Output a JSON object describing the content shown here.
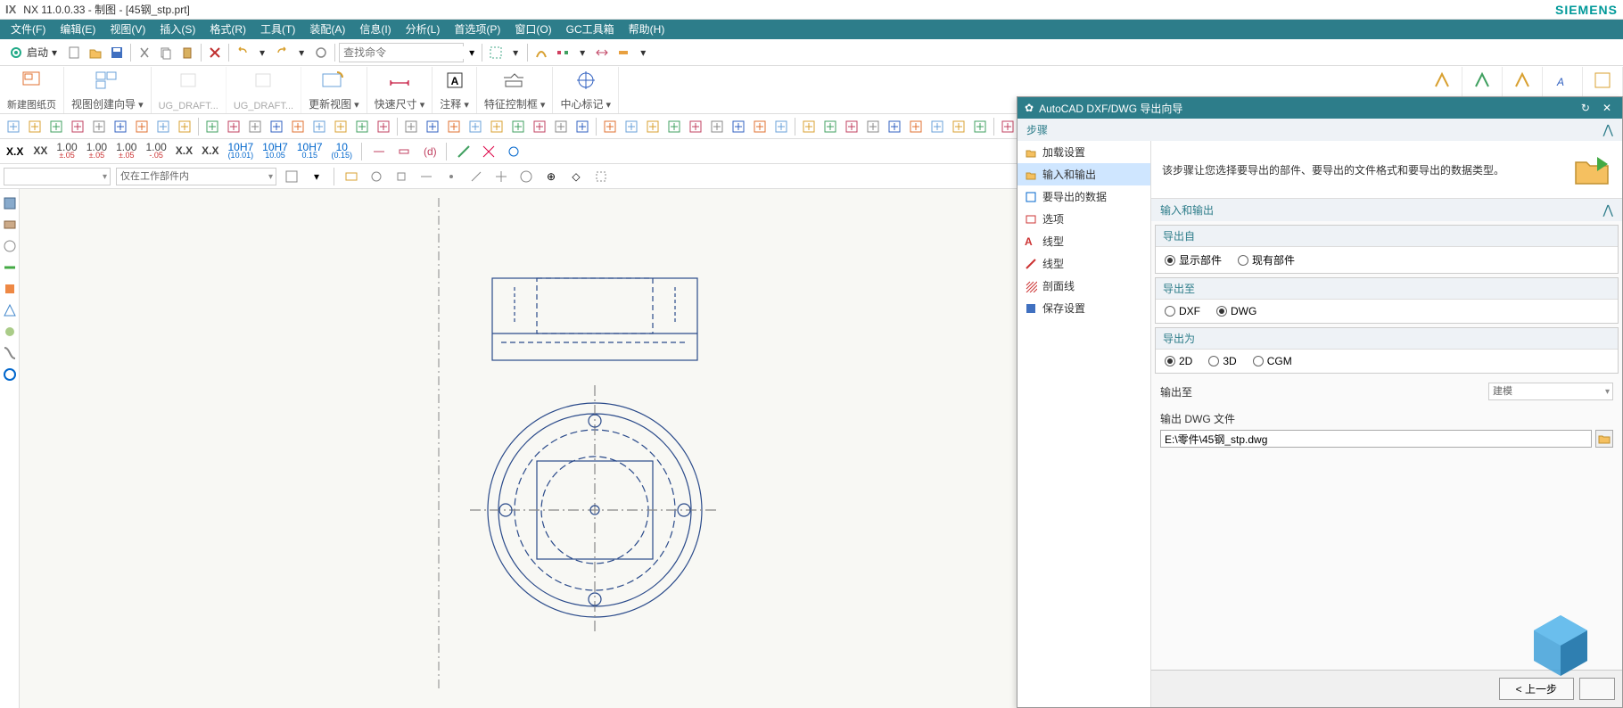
{
  "title": {
    "app": "NX 11.0.0.33",
    "mode": "制图",
    "file": "[45钢_stp.prt]",
    "brand": "SIEMENS"
  },
  "menu": [
    "文件(F)",
    "编辑(E)",
    "视图(V)",
    "插入(S)",
    "格式(R)",
    "工具(T)",
    "装配(A)",
    "信息(I)",
    "分析(L)",
    "首选项(P)",
    "窗口(O)",
    "GC工具箱",
    "帮助(H)"
  ],
  "toolbar1": {
    "start": "启动",
    "search_ph": "查找命令"
  },
  "ribbon": [
    {
      "label": "新建图纸页",
      "color": "#e07030"
    },
    {
      "label": "视图创建向导",
      "color": "#6aa0d8"
    },
    {
      "label": "UG_DRAFT...",
      "color": "#bbb"
    },
    {
      "label": "UG_DRAFT...",
      "color": "#bbb"
    },
    {
      "label": "更新视图",
      "color": "#6aa0d8"
    },
    {
      "label": "快速尺寸",
      "color": "#d04060"
    },
    {
      "label": "注释",
      "color": "#333"
    },
    {
      "label": "特征控制框",
      "color": "#555"
    },
    {
      "label": "中心标记",
      "color": "#3060c0"
    }
  ],
  "tol_row": [
    {
      "t": "XX",
      "s": ""
    },
    {
      "t": "1.00",
      "s": "±.05"
    },
    {
      "t": "1.00",
      "s": "±.05"
    },
    {
      "t": "1.00",
      "s": "±.05"
    },
    {
      "t": "1.00",
      "s": "-.05"
    },
    {
      "t": "X.X",
      "s": ""
    },
    {
      "t": "X.X",
      "s": ""
    },
    {
      "t": "10H7",
      "s": "(10.01)"
    },
    {
      "t": "10H7",
      "s": "10.05"
    },
    {
      "t": "10H7",
      "s": "0.15"
    },
    {
      "t": "10",
      "s": "(0.15)"
    }
  ],
  "filter_dd": "仅在工作部件内",
  "wizard": {
    "title": "AutoCAD DXF/DWG 导出向导",
    "steps_h": "步骤",
    "nav": [
      "加载设置",
      "输入和输出",
      "要导出的数据",
      "选项",
      "线型",
      "线型",
      "剖面线",
      "保存设置"
    ],
    "nav_sel": 1,
    "desc": "该步骤让您选择要导出的部件、要导出的文件格式和要导出的数据类型。",
    "io_h": "输入和输出",
    "grp_from": {
      "h": "导出自",
      "opts": [
        "显示部件",
        "现有部件"
      ],
      "sel": 0
    },
    "grp_to": {
      "h": "导出至",
      "opts": [
        "DXF",
        "DWG"
      ],
      "sel": 1
    },
    "grp_as": {
      "h": "导出为",
      "opts": [
        "2D",
        "3D",
        "CGM"
      ],
      "sel": 0
    },
    "out_to_lbl": "输出至",
    "out_to_val": "建模",
    "out_file_lbl": "输出 DWG 文件",
    "out_file_val": "E:\\零件\\45钢_stp.dwg",
    "btn_prev": "< 上一步"
  }
}
